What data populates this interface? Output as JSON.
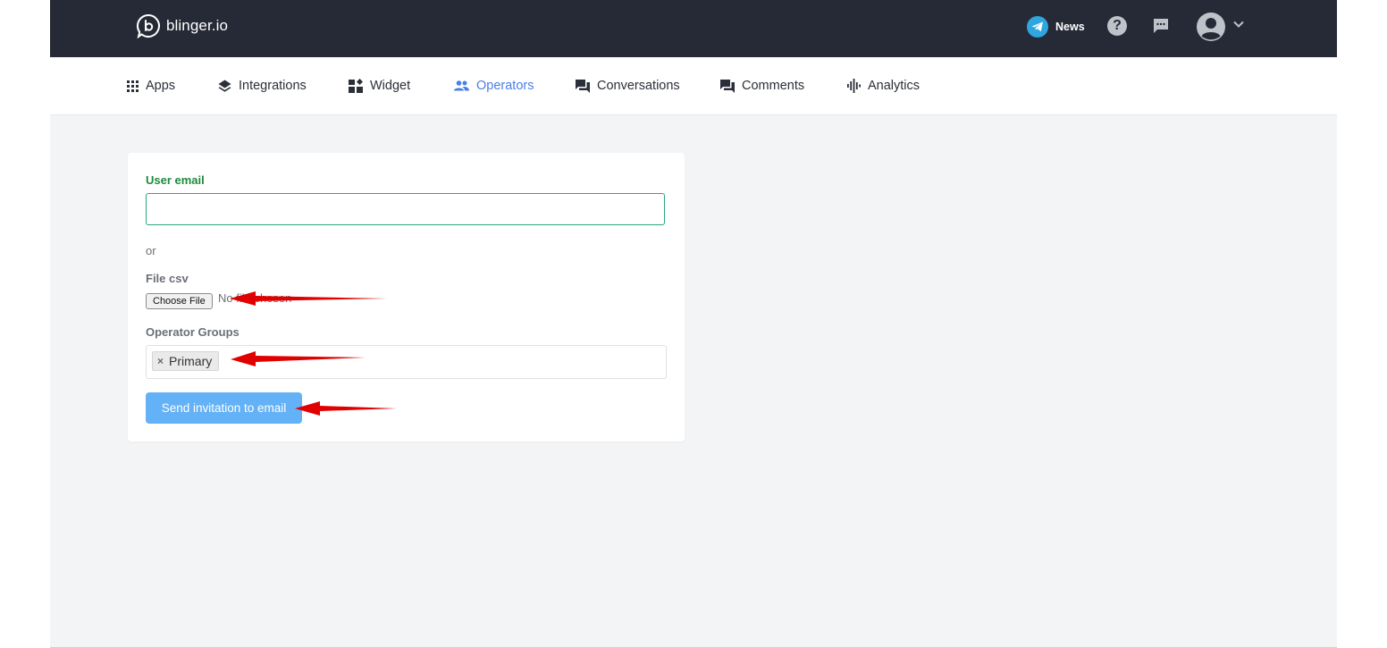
{
  "brand": {
    "name": "blinger.io"
  },
  "header": {
    "news_label": "News",
    "help_label": "?"
  },
  "nav": {
    "items": [
      {
        "label": "Apps",
        "icon": "grid-icon"
      },
      {
        "label": "Integrations",
        "icon": "layers-icon"
      },
      {
        "label": "Widget",
        "icon": "widget-icon"
      },
      {
        "label": "Operators",
        "icon": "people-icon",
        "active": true
      },
      {
        "label": "Conversations",
        "icon": "chat-icon"
      },
      {
        "label": "Comments",
        "icon": "comment-icon"
      },
      {
        "label": "Analytics",
        "icon": "analytics-icon"
      }
    ]
  },
  "form": {
    "email_label": "User email",
    "email_value": "",
    "or_text": "or",
    "file_label": "File csv",
    "file_button": "Choose File",
    "file_status": "No file chosen",
    "groups_label": "Operator Groups",
    "group_tag": "Primary",
    "tag_remove": "×",
    "submit_label": "Send invitation to email"
  },
  "colors": {
    "topbar": "#262a36",
    "accent": "#4a7fe6",
    "email_label": "#1e8a3c",
    "button": "#63b1f6",
    "annotation_arrow": "#e00000"
  }
}
